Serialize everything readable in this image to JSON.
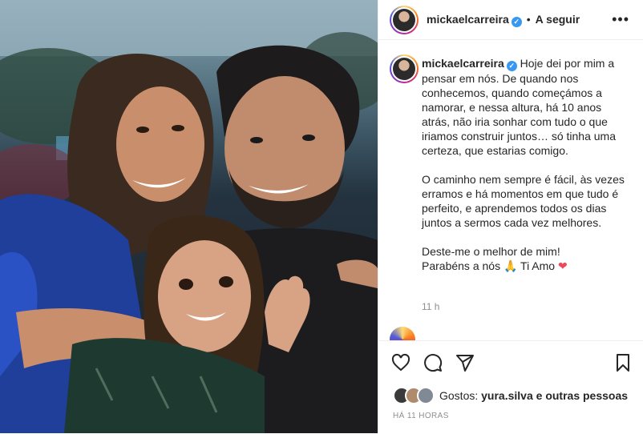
{
  "post": {
    "username": "mickaelcarreira",
    "follow_label": "A seguir",
    "more_icon": "more-horizontal-icon",
    "caption": {
      "p1": "Hoje dei por mim a pensar em nós. De quando nos conhecemos, quando começámos a namorar, e nessa altura, há 10 anos atrás, não iria sonhar com tudo o que iriamos construir juntos… só tinha uma certeza, que estarias comigo.",
      "p2": "O caminho nem sempre é fácil, às vezes erramos e há momentos em que tudo é perfeito, e aprendemos todos os dias juntos a sermos cada vez melhores.",
      "p3a": "Deste-me o melhor de mim!",
      "p3b": "Parabéns a nós",
      "p3c": "Ti Amo",
      "emoji_pray": "🙏",
      "emoji_heart": "❤"
    },
    "time": "11 h",
    "likes_label": "Gostos:",
    "likes_user": "yura.silva",
    "likes_rest": "e outras pessoas",
    "posted_ago": "HÁ 11 HORAS"
  },
  "colors": {
    "verified": "#3897f0",
    "text": "#262626",
    "muted": "#8e8e8e",
    "heart": "#ed4956"
  }
}
